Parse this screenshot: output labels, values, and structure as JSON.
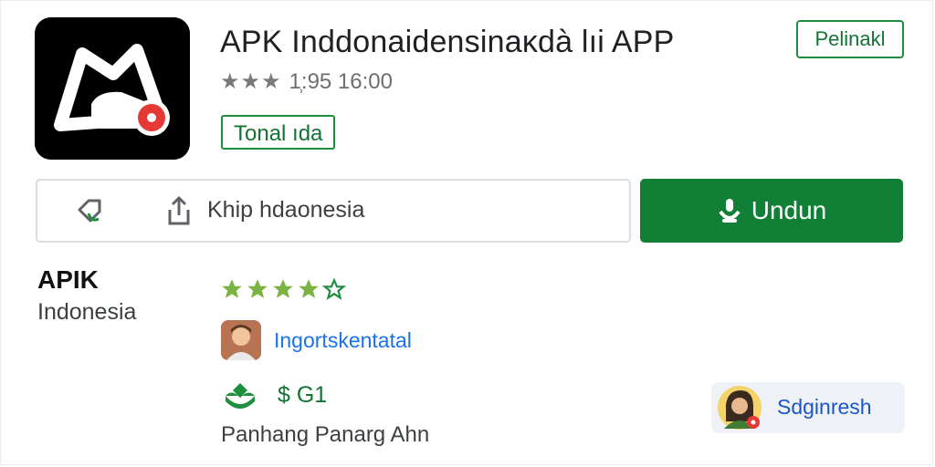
{
  "app": {
    "title": "APK Inddonaidensinaκdà lıi APP",
    "rating_value": "1̹:95 16:00",
    "rating_stars": "★★★",
    "tag": "Tonal ıda",
    "top_badge": "Pelinakl"
  },
  "actions": {
    "share_label": "Khip hdaonesia",
    "download_label": "Undun"
  },
  "developer": {
    "name": "APIK",
    "country": "Indonesia"
  },
  "details": {
    "reviewer_name": "Ingortskentatal",
    "price": "$ G1",
    "caption": "Panhang Panarg Ahn",
    "green_stars_filled": 4,
    "green_stars_total": 5
  },
  "profile": {
    "label": "Sdginresh"
  },
  "colors": {
    "accent_green": "#118036",
    "badge_green": "#1e8e3e",
    "link_blue": "#1a73e8",
    "star_green": "#7cb342"
  },
  "icons": {
    "app": "app-logo-icon",
    "wishlist": "wishlist-icon",
    "share": "share-icon",
    "download": "download-icon",
    "price": "sprout-icon",
    "star": "star-icon"
  }
}
